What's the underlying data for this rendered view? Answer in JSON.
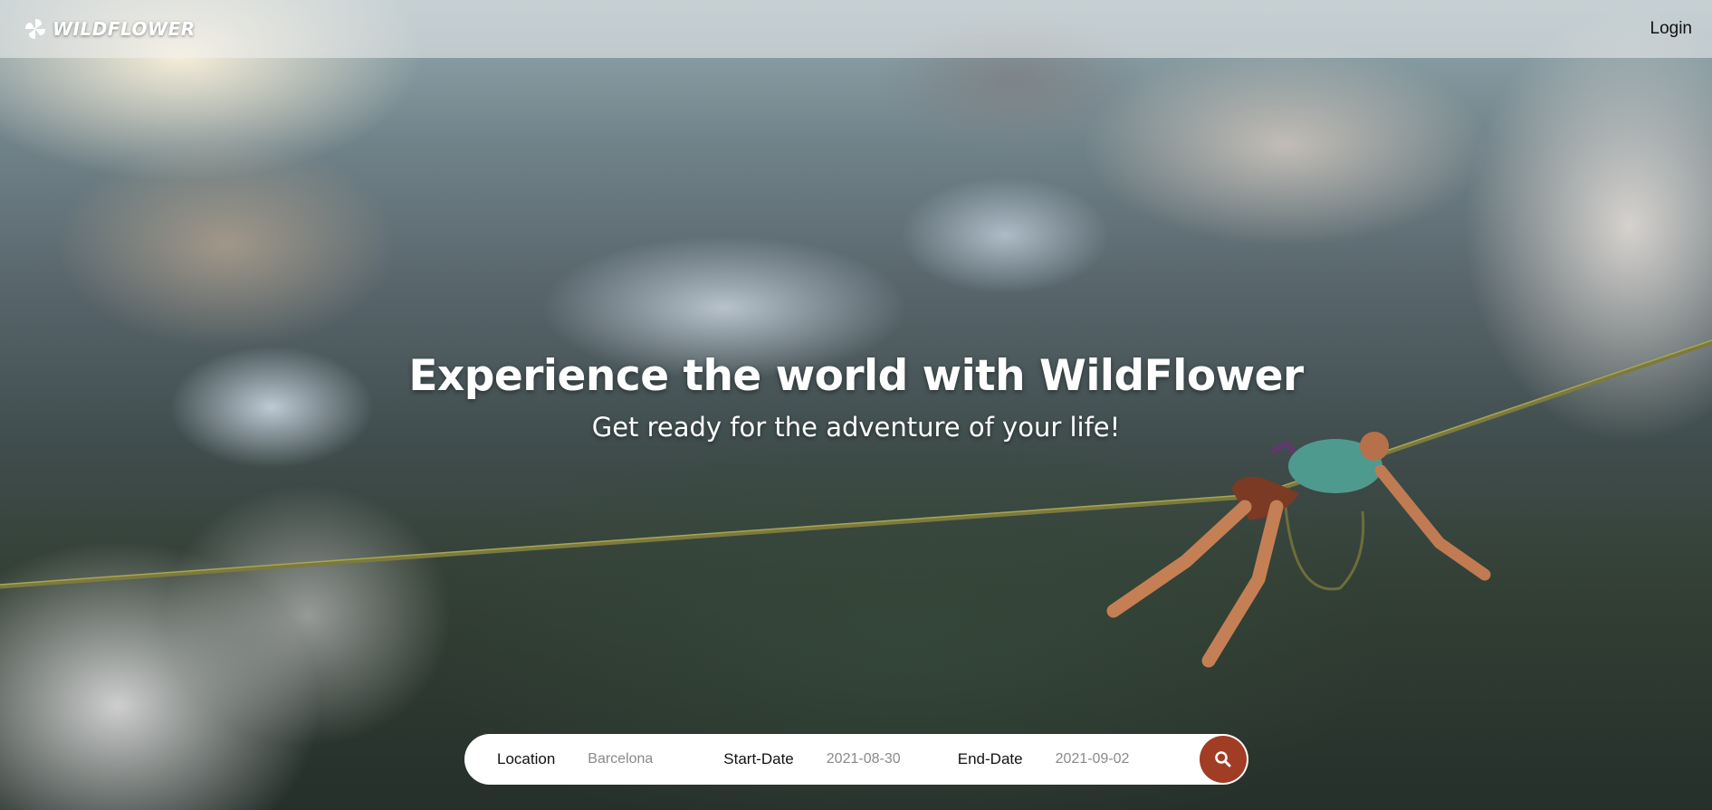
{
  "brand": {
    "name": "WILDFLOWER",
    "logo_icon": "pinwheel-logo-icon"
  },
  "nav": {
    "login_label": "Login"
  },
  "hero": {
    "title": "Experience the world with WildFlower",
    "subtitle": "Get ready for the adventure of your life!"
  },
  "search": {
    "location_label": "Location",
    "location_value": "Barcelona",
    "start_label": "Start-Date",
    "start_value": "2021-08-30",
    "end_label": "End-Date",
    "end_value": "2021-09-02",
    "button_icon": "search-icon"
  },
  "colors": {
    "accent": "#a13d25",
    "topbar": "rgba(240,240,240,0.55)",
    "text_on_image": "#ffffff",
    "input_text": "#8a8a8a"
  }
}
